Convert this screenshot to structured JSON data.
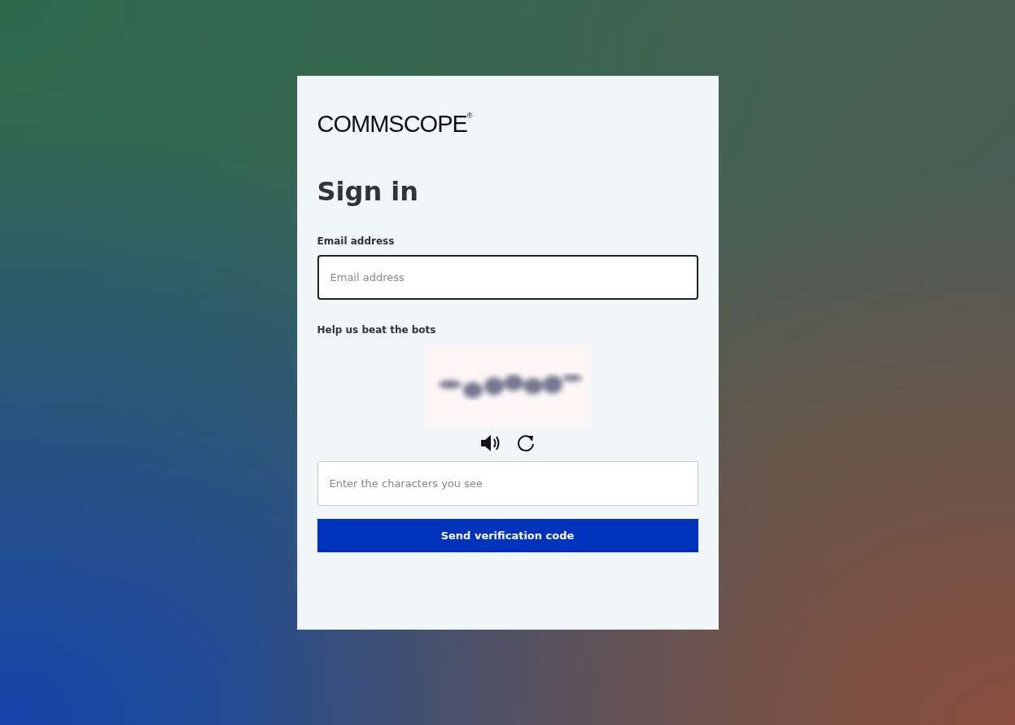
{
  "logo": {
    "text": "COMMSCOPE$^{®}$"
  },
  "heading": "Sign in",
  "email": {
    "label": "Email address",
    "placeholder": "Email address",
    "focused": true
  },
  "captcha": {
    "label": "Help us beat the bots",
    "placeholder": "Enter the characters you see",
    "focused": false
  },
  "submit_button": "Send verification code"
}
